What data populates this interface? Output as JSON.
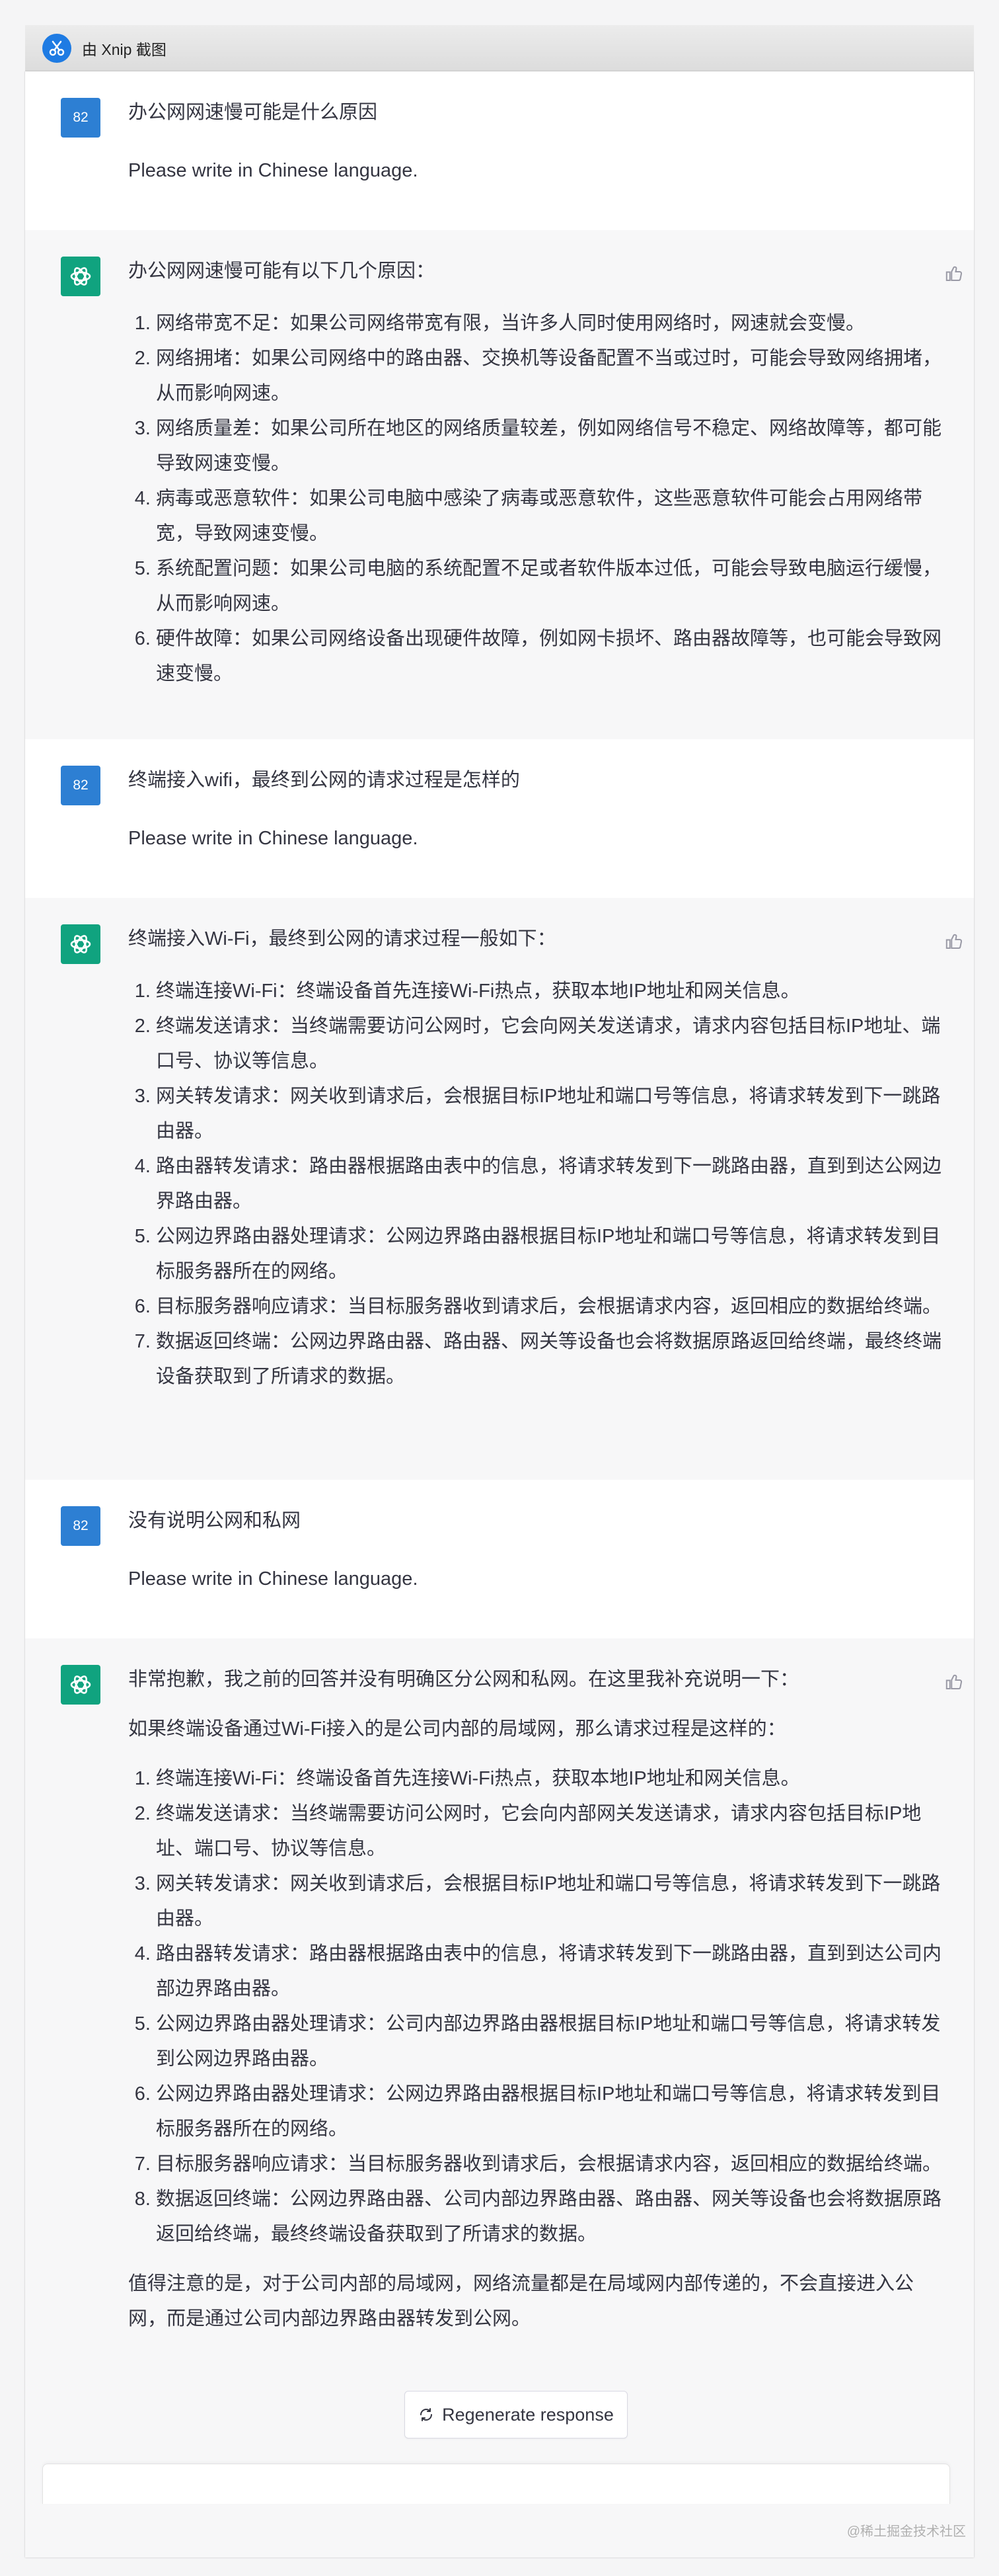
{
  "app": {
    "title": "由 Xnip 截图"
  },
  "user_avatar_label": "82",
  "regenerate_label": "Regenerate response",
  "watermark": "@稀土掘金技术社区",
  "messages": [
    {
      "role": "user",
      "lines": [
        "办公网网速慢可能是什么原因",
        "Please write in Chinese language."
      ]
    },
    {
      "role": "assistant",
      "intro": "办公网网速慢可能有以下几个原因：",
      "items": [
        "网络带宽不足：如果公司网络带宽有限，当许多人同时使用网络时，网速就会变慢。",
        "网络拥堵：如果公司网络中的路由器、交换机等设备配置不当或过时，可能会导致网络拥堵，从而影响网速。",
        "网络质量差：如果公司所在地区的网络质量较差，例如网络信号不稳定、网络故障等，都可能导致网速变慢。",
        "病毒或恶意软件：如果公司电脑中感染了病毒或恶意软件，这些恶意软件可能会占用网络带宽，导致网速变慢。",
        "系统配置问题：如果公司电脑的系统配置不足或者软件版本过低，可能会导致电脑运行缓慢，从而影响网速。",
        "硬件故障：如果公司网络设备出现硬件故障，例如网卡损坏、路由器故障等，也可能会导致网速变慢。"
      ]
    },
    {
      "role": "user",
      "lines": [
        "终端接入wifi，最终到公网的请求过程是怎样的",
        "Please write in Chinese language."
      ]
    },
    {
      "role": "assistant",
      "intro": "终端接入Wi-Fi，最终到公网的请求过程一般如下：",
      "items": [
        "终端连接Wi-Fi：终端设备首先连接Wi-Fi热点，获取本地IP地址和网关信息。",
        "终端发送请求：当终端需要访问公网时，它会向网关发送请求，请求内容包括目标IP地址、端口号、协议等信息。",
        "网关转发请求：网关收到请求后，会根据目标IP地址和端口号等信息，将请求转发到下一跳路由器。",
        "路由器转发请求：路由器根据路由表中的信息，将请求转发到下一跳路由器，直到到达公网边界路由器。",
        "公网边界路由器处理请求：公网边界路由器根据目标IP地址和端口号等信息，将请求转发到目标服务器所在的网络。",
        "目标服务器响应请求：当目标服务器收到请求后，会根据请求内容，返回相应的数据给终端。",
        "数据返回终端：公网边界路由器、路由器、网关等设备也会将数据原路返回给终端，最终终端设备获取到了所请求的数据。"
      ]
    },
    {
      "role": "user",
      "lines": [
        "没有说明公网和私网",
        "Please write in Chinese language."
      ]
    },
    {
      "role": "assistant",
      "intro": "非常抱歉，我之前的回答并没有明确区分公网和私网。在这里我补充说明一下：",
      "intro2": "如果终端设备通过Wi-Fi接入的是公司内部的局域网，那么请求过程是这样的：",
      "items": [
        "终端连接Wi-Fi：终端设备首先连接Wi-Fi热点，获取本地IP地址和网关信息。",
        "终端发送请求：当终端需要访问公网时，它会向内部网关发送请求，请求内容包括目标IP地址、端口号、协议等信息。",
        "网关转发请求：网关收到请求后，会根据目标IP地址和端口号等信息，将请求转发到下一跳路由器。",
        "路由器转发请求：路由器根据路由表中的信息，将请求转发到下一跳路由器，直到到达公司内部边界路由器。",
        "公网边界路由器处理请求：公司内部边界路由器根据目标IP地址和端口号等信息，将请求转发到公网边界路由器。",
        "公网边界路由器处理请求：公网边界路由器根据目标IP地址和端口号等信息，将请求转发到目标服务器所在的网络。",
        "目标服务器响应请求：当目标服务器收到请求后，会根据请求内容，返回相应的数据给终端。",
        "数据返回终端：公网边界路由器、公司内部边界路由器、路由器、网关等设备也会将数据原路返回给终端，最终终端设备获取到了所请求的数据。"
      ],
      "outro": "值得注意的是，对于公司内部的局域网，网络流量都是在局域网内部传递的，不会直接进入公网，而是通过公司内部边界路由器转发到公网。"
    }
  ]
}
